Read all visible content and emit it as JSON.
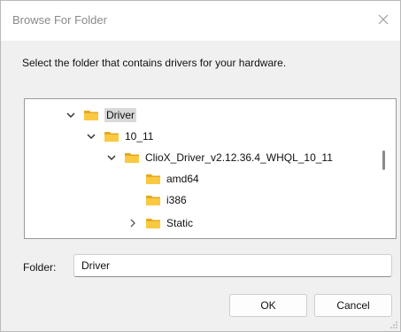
{
  "dialog": {
    "title": "Browse For Folder",
    "instruction": "Select the folder that contains drivers for your hardware."
  },
  "tree": {
    "items": [
      {
        "label": "Driver",
        "expanded": true,
        "selected": true
      },
      {
        "label": "10_11",
        "expanded": true
      },
      {
        "label": "ClioX_Driver_v2.12.36.4_WHQL_10_11",
        "expanded": true
      },
      {
        "label": "amd64"
      },
      {
        "label": "i386"
      },
      {
        "label": "Static",
        "expanded": false
      }
    ]
  },
  "folder": {
    "label": "Folder:",
    "value": "Driver"
  },
  "buttons": {
    "ok": "OK",
    "cancel": "Cancel"
  },
  "colors": {
    "folder_yellow": "#f9c941",
    "folder_dark": "#e4a91f"
  },
  "icons": {
    "close": "close-icon",
    "expand": "chevron-down-icon",
    "collapse": "chevron-right-icon",
    "folder": "folder-icon"
  }
}
